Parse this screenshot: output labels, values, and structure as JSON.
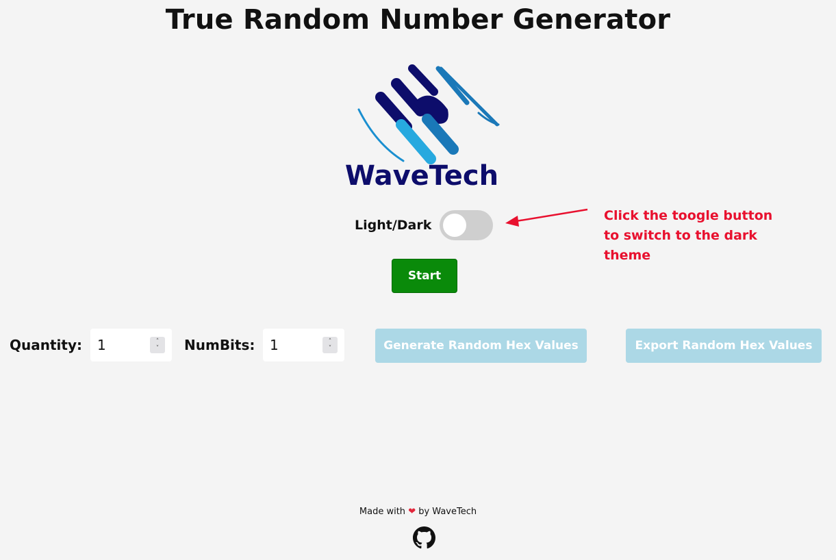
{
  "header": {
    "title": "True Random Number Generator"
  },
  "logo": {
    "text": "WaveTech",
    "colors": {
      "navy": "#0d0d6b",
      "blue": "#1a8fd0",
      "light_blue": "#27a9df"
    }
  },
  "theme": {
    "label": "Light/Dark",
    "dark_enabled": false
  },
  "annotation": {
    "text": "Click the toogle button to switch to the dark theme",
    "color": "#e8102e"
  },
  "start_button": {
    "label": "Start",
    "color": "#0a8a0a"
  },
  "controls": {
    "quantity_label": "Quantity:",
    "quantity_value": "1",
    "numbits_label": "NumBits:",
    "numbits_value": "1",
    "generate_label": "Generate Random Hex Values",
    "export_label": "Export Random Hex Values",
    "disabled_button_color": "#acd8e6"
  },
  "footer": {
    "made_with": "Made with",
    "heart_icon": "heart-icon",
    "by": "by WaveTech",
    "github_icon": "github-icon"
  }
}
